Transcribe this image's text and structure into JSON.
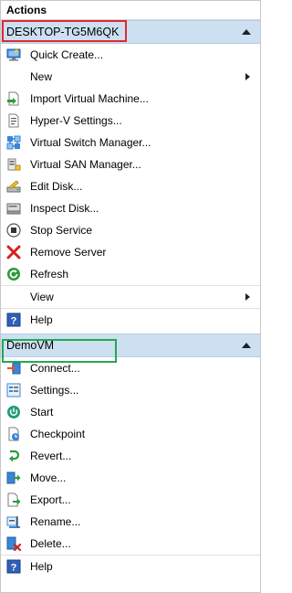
{
  "title": "Actions",
  "host_section": {
    "header": "DESKTOP-TG5M6QK",
    "items": [
      {
        "label": "Quick Create...",
        "icon": "quick-create-icon"
      },
      {
        "label": "New",
        "icon": "none",
        "submenu": true
      },
      {
        "label": "Import Virtual Machine...",
        "icon": "import-vm-icon"
      },
      {
        "label": "Hyper-V Settings...",
        "icon": "hyperv-settings-icon"
      },
      {
        "label": "Virtual Switch Manager...",
        "icon": "virtual-switch-icon"
      },
      {
        "label": "Virtual SAN Manager...",
        "icon": "virtual-san-icon"
      },
      {
        "label": "Edit Disk...",
        "icon": "edit-disk-icon"
      },
      {
        "label": "Inspect Disk...",
        "icon": "inspect-disk-icon"
      },
      {
        "label": "Stop Service",
        "icon": "stop-service-icon"
      },
      {
        "label": "Remove Server",
        "icon": "remove-server-icon"
      },
      {
        "label": "Refresh",
        "icon": "refresh-icon"
      },
      {
        "label": "View",
        "icon": "none",
        "submenu": true
      },
      {
        "label": "Help",
        "icon": "help-icon"
      }
    ]
  },
  "vm_section": {
    "header": "DemoVM",
    "items": [
      {
        "label": "Connect...",
        "icon": "connect-icon"
      },
      {
        "label": "Settings...",
        "icon": "vm-settings-icon"
      },
      {
        "label": "Start",
        "icon": "start-icon"
      },
      {
        "label": "Checkpoint",
        "icon": "checkpoint-icon"
      },
      {
        "label": "Revert...",
        "icon": "revert-icon"
      },
      {
        "label": "Move...",
        "icon": "move-icon"
      },
      {
        "label": "Export...",
        "icon": "export-icon"
      },
      {
        "label": "Rename...",
        "icon": "rename-icon"
      },
      {
        "label": "Delete...",
        "icon": "delete-icon"
      },
      {
        "label": "Help",
        "icon": "help-icon"
      }
    ]
  },
  "colors": {
    "section_header_bg": "#cde0f2",
    "highlight_host": "#e0282e",
    "highlight_vm": "#23a84f"
  }
}
